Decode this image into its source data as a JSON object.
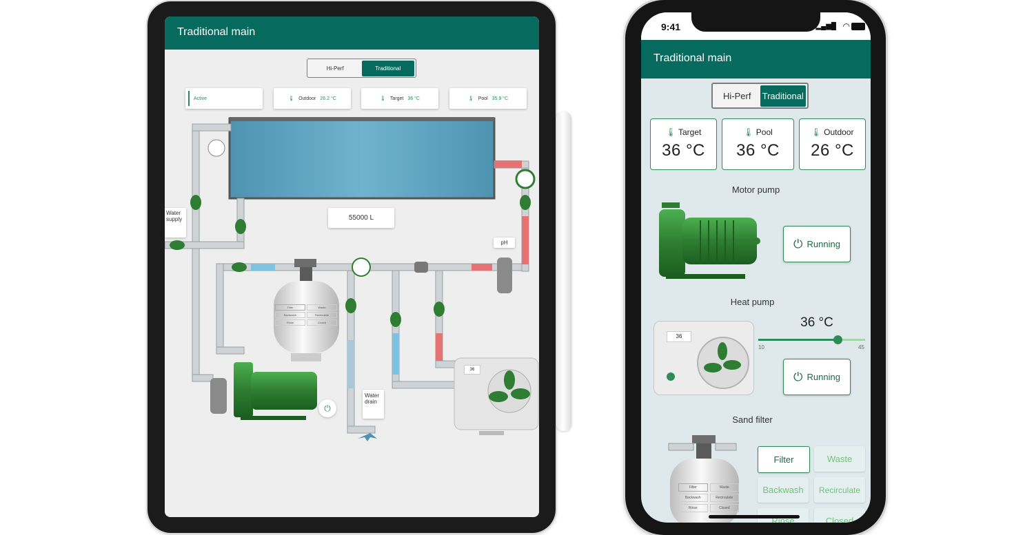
{
  "colors": {
    "primary": "#066b5e",
    "accent": "#2e8b57",
    "water": "#5fa8c6",
    "hot_pipe": "#e57373",
    "cold_pipe": "#7fc1e0"
  },
  "tablet": {
    "title": "Traditional main",
    "mode_toggle": {
      "options": [
        "Hi-Perf",
        "Traditional"
      ],
      "selected": "Traditional"
    },
    "status": "Active",
    "cards": [
      {
        "label": "Outdoor",
        "value": "26.2 °C",
        "icon": "thermometer-icon"
      },
      {
        "label": "Target",
        "value": "36 °C",
        "icon": "thermometer-icon"
      },
      {
        "label": "Pool",
        "value": "35.9 °C",
        "icon": "thermometer-icon"
      }
    ],
    "pool_volume": "55000 L",
    "labels": {
      "water_supply": "Water supply",
      "ph": "pH",
      "water_drain": "Water drain"
    },
    "filter_valve": {
      "filter": "Filter",
      "waste": "Waste",
      "backwash": "Backwash",
      "recirculate": "Recirculate",
      "rinse": "Rinse",
      "closed": "Closed"
    },
    "heat_pump_display": "36"
  },
  "phone": {
    "time": "9:41",
    "title": "Traditional main",
    "mode_toggle": {
      "options": [
        "Hi-Perf",
        "Traditional"
      ],
      "selected": "Traditional"
    },
    "cards": [
      {
        "label": "Target",
        "value": "36 °C",
        "icon": "thermometer-icon"
      },
      {
        "label": "Pool",
        "value": "36 °C",
        "icon": "thermometer-icon"
      },
      {
        "label": "Outdoor",
        "value": "26 °C",
        "icon": "thermometer-icon"
      }
    ],
    "motor_pump": {
      "title": "Motor pump",
      "state": "Running"
    },
    "heat_pump": {
      "title": "Heat pump",
      "setpoint": "36 °C",
      "min": "10",
      "max": "45",
      "slider_value": 36,
      "state": "Running",
      "display": "36"
    },
    "sand_filter": {
      "title": "Sand filter",
      "modes": [
        "Filter",
        "Waste",
        "Backwash",
        "Recirculate",
        "Rinse",
        "Closed"
      ],
      "selected": "Filter"
    }
  }
}
